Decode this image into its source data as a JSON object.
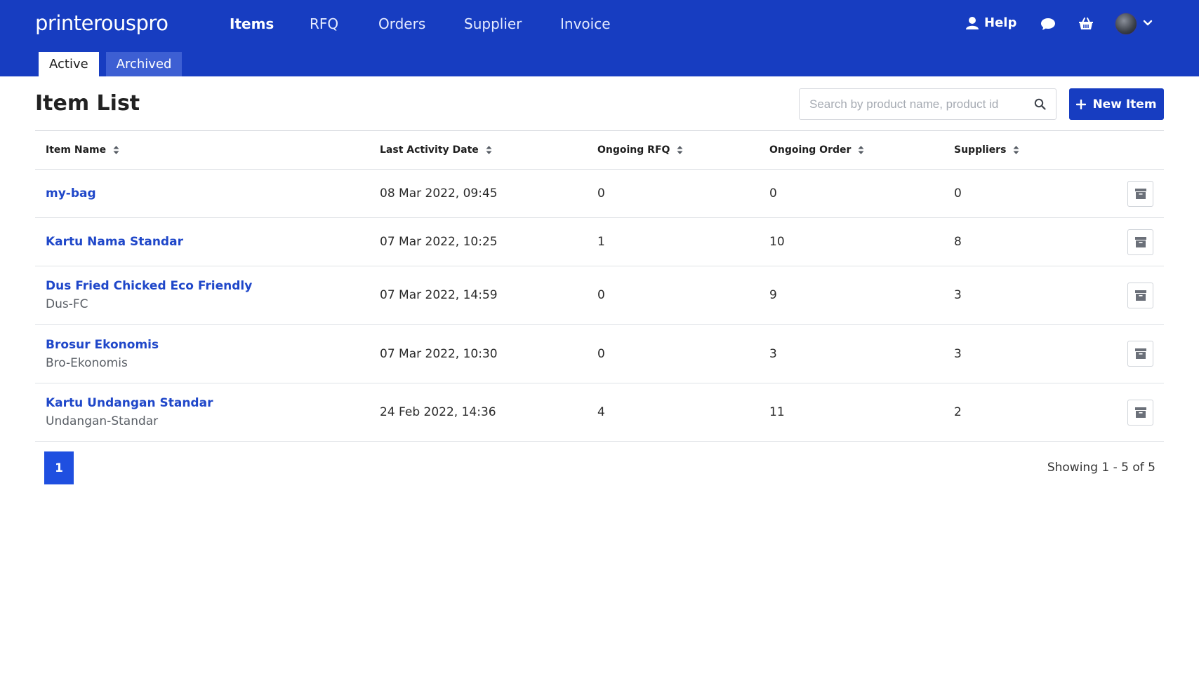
{
  "brand": {
    "logo_text": "printerouspro"
  },
  "nav": {
    "items": [
      {
        "label": "Items",
        "active": true
      },
      {
        "label": "RFQ",
        "active": false
      },
      {
        "label": "Orders",
        "active": false
      },
      {
        "label": "Supplier",
        "active": false
      },
      {
        "label": "Invoice",
        "active": false
      }
    ],
    "help_label": "Help",
    "icons": [
      "user-icon",
      "chat-icon",
      "basket-icon",
      "avatar",
      "chevron-down-icon"
    ]
  },
  "subtabs": [
    {
      "label": "Active",
      "active": true
    },
    {
      "label": "Archived",
      "active": false
    }
  ],
  "page": {
    "title": "Item List",
    "search_placeholder": "Search by product name, product id",
    "new_item_label": "New Item"
  },
  "table": {
    "columns": [
      "Item Name",
      "Last Activity Date",
      "Ongoing RFQ",
      "Ongoing Order",
      "Suppliers"
    ],
    "rows": [
      {
        "name": "my-bag",
        "code": "",
        "date": "08 Mar 2022, 09:45",
        "rfq": "0",
        "order": "0",
        "suppliers": "0"
      },
      {
        "name": "Kartu Nama Standar",
        "code": "",
        "date": "07 Mar 2022, 10:25",
        "rfq": "1",
        "order": "10",
        "suppliers": "8"
      },
      {
        "name": "Dus Fried Chicked Eco Friendly",
        "code": "Dus-FC",
        "date": "07 Mar 2022, 14:59",
        "rfq": "0",
        "order": "9",
        "suppliers": "3"
      },
      {
        "name": "Brosur Ekonomis",
        "code": "Bro-Ekonomis",
        "date": "07 Mar 2022, 10:30",
        "rfq": "0",
        "order": "3",
        "suppliers": "3"
      },
      {
        "name": "Kartu Undangan Standar",
        "code": "Undangan-Standar",
        "date": "24 Feb 2022, 14:36",
        "rfq": "4",
        "order": "11",
        "suppliers": "2"
      }
    ]
  },
  "pagination": {
    "current_page": "1",
    "showing_text": "Showing 1 - 5 of 5"
  },
  "colors": {
    "primary": "#173dc1",
    "link": "#1f47c9",
    "page_button": "#1f4fe0"
  }
}
